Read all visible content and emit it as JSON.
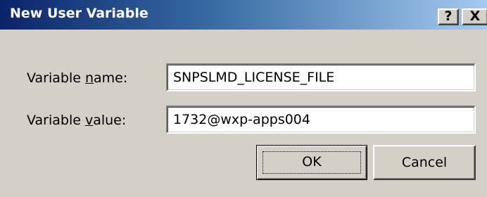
{
  "window": {
    "title": "New User Variable",
    "help_label": "?",
    "close_label": "X"
  },
  "form": {
    "name": {
      "label_prefix": "Variable ",
      "label_access": "n",
      "label_suffix": "ame:",
      "value": "SNPSLMD_LICENSE_FILE"
    },
    "value": {
      "label_prefix": "Variable ",
      "label_access": "v",
      "label_suffix": "alue:",
      "value": "1732@wxp-apps004"
    }
  },
  "buttons": {
    "ok_label": "OK",
    "cancel_label": "Cancel"
  },
  "colors": {
    "title_gradient_start": "#0a246a",
    "title_gradient_end": "#a6caf0",
    "dialog_face": "#d4d0c8"
  }
}
